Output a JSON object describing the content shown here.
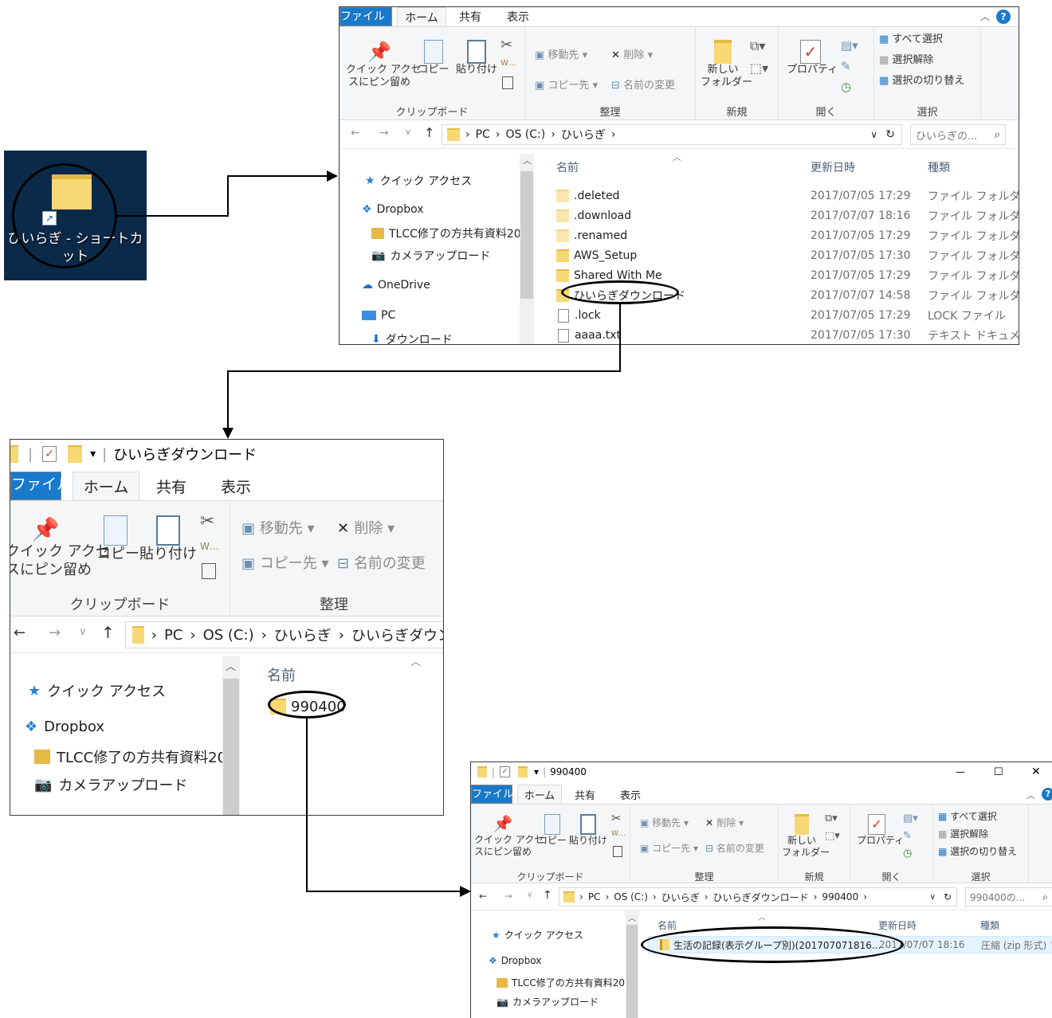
{
  "desktop": {
    "shortcut_label": "ひいらぎ - ショートカット"
  },
  "ribbon_tabs": [
    "ファイル",
    "ホーム",
    "共有",
    "表示"
  ],
  "ribbon": {
    "pin": "クイック アクセスにピン留め",
    "pin_line1": "クイック アクセ",
    "pin_line2": "スにピン留め",
    "copy": "コピー",
    "paste": "貼り付け",
    "clipboard_group": "クリップボード",
    "move_to": "移動先",
    "delete": "削除",
    "copy_to": "コピー先",
    "rename": "名前の変更",
    "organize_group": "整理",
    "new_folder_line1": "新しい",
    "new_folder_line2": "フォルダー",
    "new_group": "新規",
    "properties": "プロパティ",
    "open_group": "開く",
    "select_all": "すべて選択",
    "select_none": "選択解除",
    "invert_selection": "選択の切り替え",
    "select_group": "選択"
  },
  "nav_items": {
    "quick_access": "クイック アクセス",
    "dropbox": "Dropbox",
    "tlcc": "TLCC修了の方共有資料20",
    "camera": "カメラアップロード",
    "onedrive": "OneDrive",
    "pc": "PC",
    "downloads": "ダウンロード"
  },
  "column_headers": {
    "name": "名前",
    "modified": "更新日時",
    "type": "種類"
  },
  "window1": {
    "breadcrumb": [
      "PC",
      "OS (C:)",
      "ひいらぎ"
    ],
    "search_placeholder": "ひいらぎの...",
    "files": [
      {
        "name": ".deleted",
        "date": "2017/07/05 17:29",
        "type": "ファイル フォルダー",
        "kind": "folder-light"
      },
      {
        "name": ".download",
        "date": "2017/07/07 18:16",
        "type": "ファイル フォルダー",
        "kind": "folder-light"
      },
      {
        "name": ".renamed",
        "date": "2017/07/05 17:29",
        "type": "ファイル フォルダー",
        "kind": "folder-light"
      },
      {
        "name": "AWS_Setup",
        "date": "2017/07/05 17:30",
        "type": "ファイル フォルダー",
        "kind": "folder"
      },
      {
        "name": "Shared With Me",
        "date": "2017/07/05 17:29",
        "type": "ファイル フォルダー",
        "kind": "folder"
      },
      {
        "name": "ひいらぎダウンロード",
        "date": "2017/07/07 14:58",
        "type": "ファイル フォルダー",
        "kind": "folder"
      },
      {
        "name": ".lock",
        "date": "2017/07/05 17:29",
        "type": "LOCK ファイル",
        "kind": "file"
      },
      {
        "name": "aaaa.txt",
        "date": "2017/07/05 17:30",
        "type": "テキスト ドキュメント",
        "kind": "text"
      }
    ]
  },
  "window2": {
    "title": "ひいらぎダウンロード",
    "breadcrumb": [
      "PC",
      "OS (C:)",
      "ひいらぎ",
      "ひいらぎダウン"
    ],
    "files": [
      {
        "name": "990400"
      }
    ]
  },
  "window3": {
    "title": "990400",
    "breadcrumb": [
      "PC",
      "OS (C:)",
      "ひいらぎ",
      "ひいらぎダウンロード",
      "990400"
    ],
    "search_placeholder": "990400の...",
    "files": [
      {
        "name": "生活の記録(表示グループ別)(201707071816...",
        "date": "2017/07/07 18:16",
        "type": "圧縮 (zip 形式) フ"
      }
    ],
    "window_controls": {
      "minimize": "—",
      "maximize": "☐",
      "close": "✕"
    }
  },
  "colors": {
    "file_tab": "#1979ca",
    "folder": "#f8d775",
    "desktop_bg": "#0b2a4a",
    "accent_blue": "#1979ca"
  }
}
